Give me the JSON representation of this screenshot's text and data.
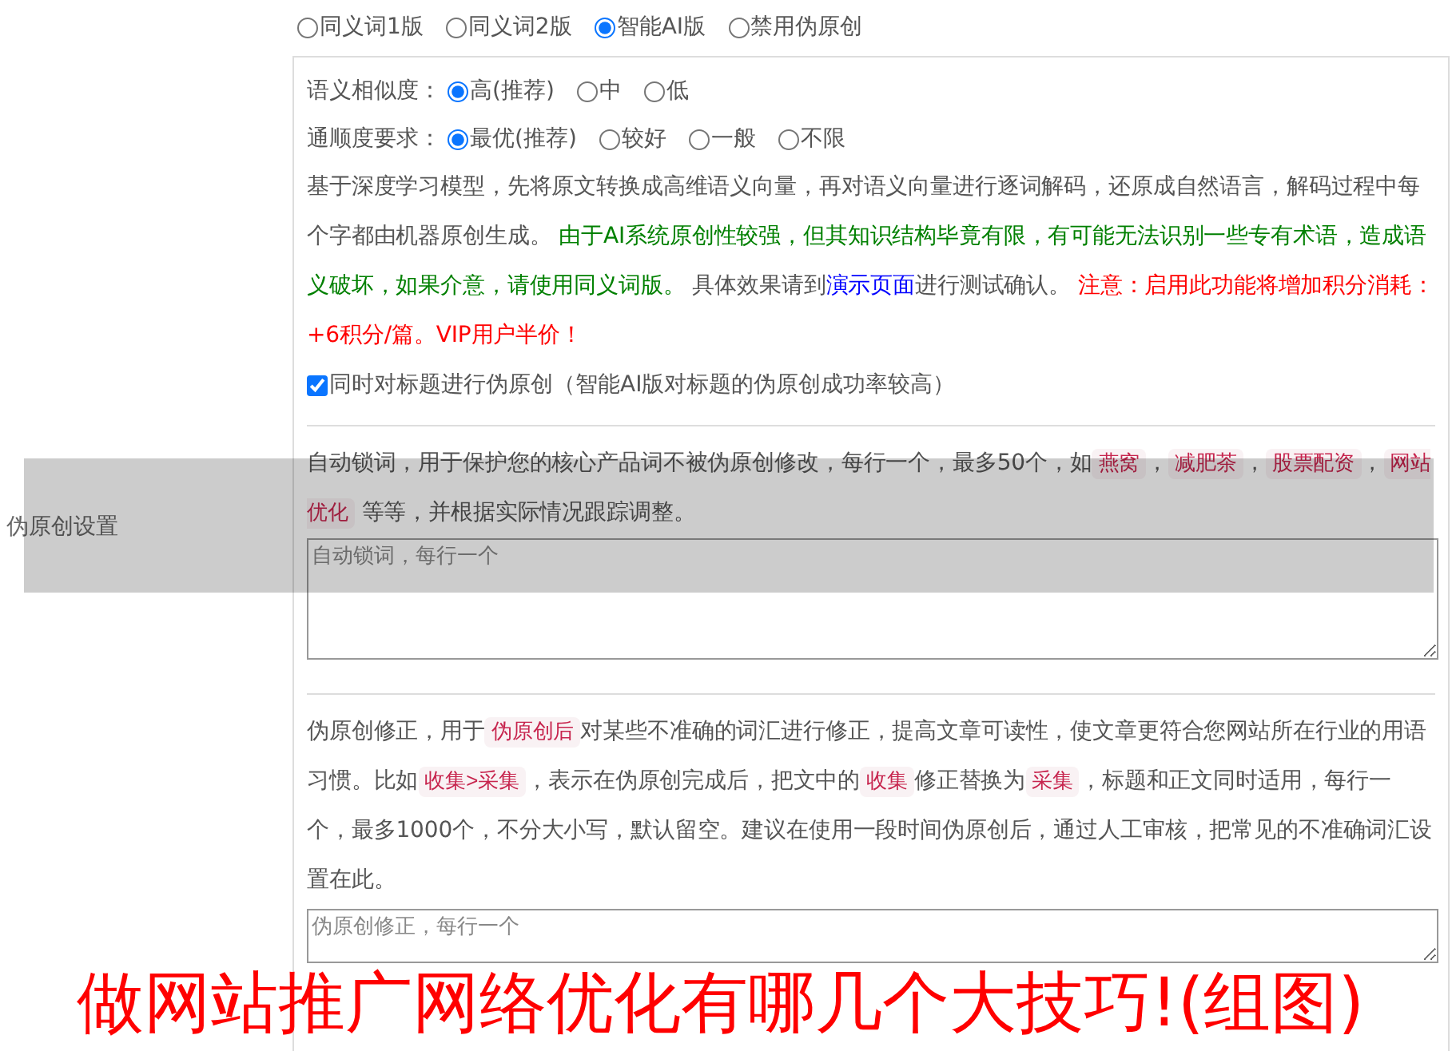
{
  "version_options": [
    {
      "label": "同义词1版",
      "selected": false
    },
    {
      "label": "同义词2版",
      "selected": false
    },
    {
      "label": "智能AI版",
      "selected": true
    },
    {
      "label": "禁用伪原创",
      "selected": false
    }
  ],
  "similarity": {
    "label": "语义相似度：",
    "options": [
      {
        "label": "高(推荐)",
        "selected": true
      },
      {
        "label": "中",
        "selected": false
      },
      {
        "label": "低",
        "selected": false
      }
    ]
  },
  "fluency": {
    "label": "通顺度要求：",
    "options": [
      {
        "label": "最优(推荐)",
        "selected": true
      },
      {
        "label": "较好",
        "selected": false
      },
      {
        "label": "一般",
        "selected": false
      },
      {
        "label": "不限",
        "selected": false
      }
    ]
  },
  "description": [
    {
      "kind": "text",
      "text": "基于深度学习模型，先将原文转换成高维语义向量，再对语义向量进行逐词解码，还原成自然语言，解码过程中每个字都由机器原创生成。 "
    },
    {
      "kind": "success",
      "text": "由于AI系统原创性较强，但其知识结构毕竟有限，有可能无法识别一些专有术语，造成语义破坏，如果介意，请使用同义词版。"
    },
    {
      "kind": "text",
      "text": " 具体效果请到"
    },
    {
      "kind": "link",
      "text": "演示页面"
    },
    {
      "kind": "text",
      "text": "进行测试确认。 "
    },
    {
      "kind": "warning",
      "text": "注意：启用此功能将增加积分消耗：+6积分/篇。VIP用户半价！"
    }
  ],
  "title_option": {
    "label": "同时对标题进行伪原创（智能AI版对标题的伪原创成功率较高）",
    "checked": true
  },
  "section_label": "伪原创设置",
  "lock_words": {
    "description": [
      {
        "kind": "text",
        "text": "自动锁词，用于保护您的核心产品词不被伪原创修改，每行一个，最多50个，如"
      },
      {
        "kind": "tag",
        "text": "燕窝"
      },
      {
        "kind": "text",
        "text": "，"
      },
      {
        "kind": "tag",
        "text": "减肥茶"
      },
      {
        "kind": "text",
        "text": "，"
      },
      {
        "kind": "tag",
        "text": "股票配资"
      },
      {
        "kind": "text",
        "text": "，"
      },
      {
        "kind": "tag",
        "text": "网站优化"
      },
      {
        "kind": "text",
        "text": " 等等，并根据实际情况跟踪调整。"
      }
    ],
    "placeholder": "自动锁词，每行一个"
  },
  "corrections": {
    "description": [
      {
        "kind": "text",
        "text": "伪原创修正，用于"
      },
      {
        "kind": "tag",
        "text": "伪原创后"
      },
      {
        "kind": "text",
        "text": "对某些不准确的词汇进行修正，提高文章可读性，使文章更符合您网站所在行业的用语习惯。比如"
      },
      {
        "kind": "tag",
        "text": "收集>采集"
      },
      {
        "kind": "text",
        "text": "，表示在伪原创完成后，把文中的"
      },
      {
        "kind": "tag",
        "text": "收集"
      },
      {
        "kind": "text",
        "text": "修正替换为"
      },
      {
        "kind": "tag",
        "text": "采集"
      },
      {
        "kind": "text",
        "text": "，标题和正文同时适用，每行一个，最多1000个，不分大小写，默认留空。建议在使用一段时间伪原创后，通过人工审核，把常见的不准确词汇设置在此。"
      }
    ],
    "placeholder": "伪原创修正，每行一个"
  },
  "caption": "做网站推广网络优化有哪几个大技巧!(组图)"
}
